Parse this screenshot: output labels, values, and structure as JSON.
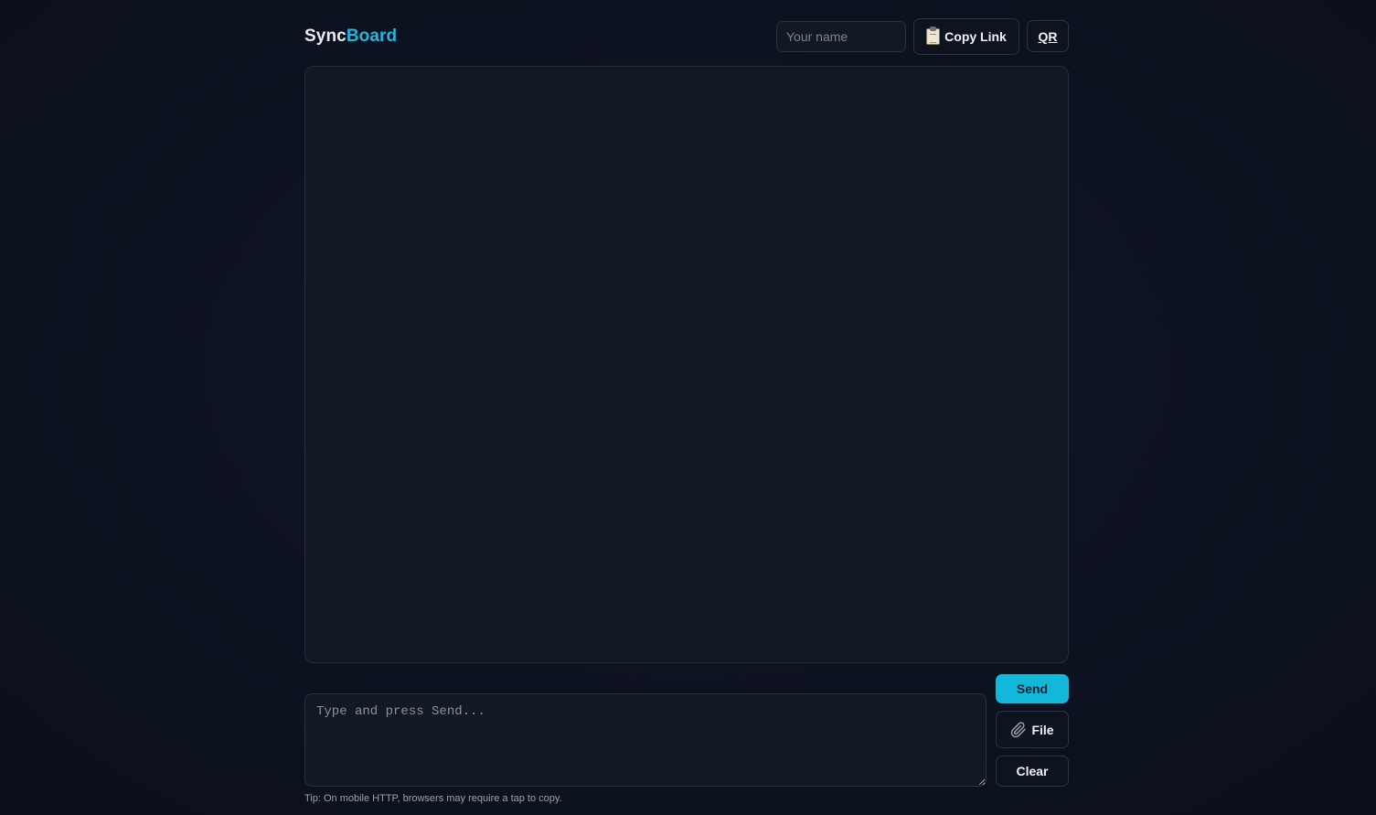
{
  "app": {
    "brand_part1": "Sync",
    "brand_part2": "Board",
    "accent_color": "#1fb6e0"
  },
  "header": {
    "name_placeholder": "Your name",
    "name_value": "",
    "copy_link_icon": "clipboard-icon",
    "copy_link_label": "Copy Link",
    "qr_label": "QR"
  },
  "composer": {
    "placeholder": "Type and press Send...",
    "value": ""
  },
  "actions": {
    "send_label": "Send",
    "file_icon": "paperclip-icon",
    "file_label": "File",
    "clear_label": "Clear"
  },
  "footer": {
    "tip": "Tip: On mobile HTTP, browsers may require a tap to copy."
  }
}
